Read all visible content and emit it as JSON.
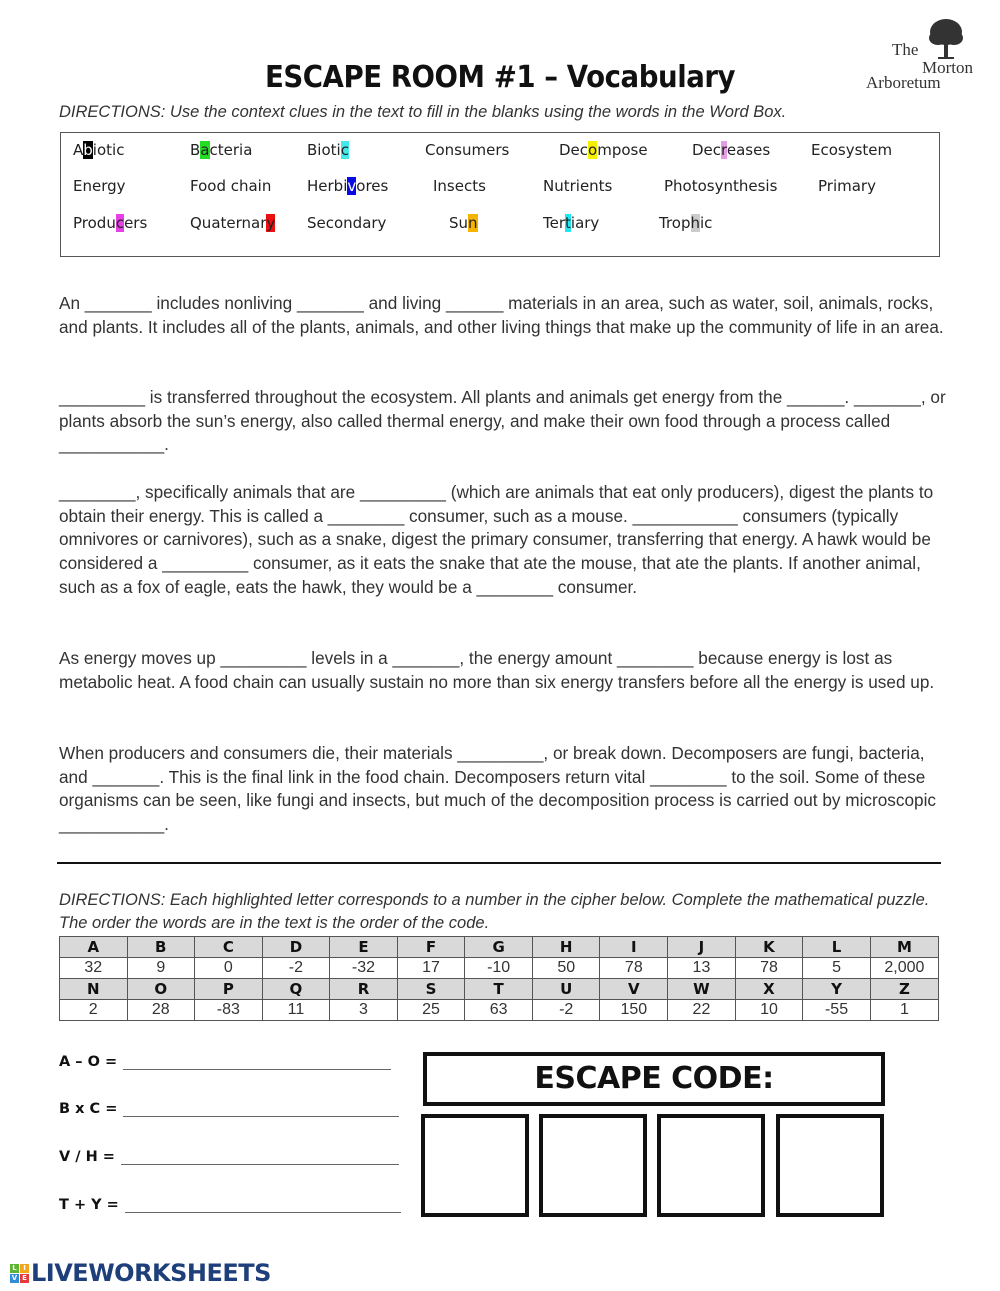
{
  "header": {
    "title": "ESCAPE ROOM #1 – Vocabulary",
    "logo": {
      "line1": "The",
      "line2": "Morton",
      "line3": "Arboretum",
      "icon": "tree-icon"
    }
  },
  "directions1": "DIRECTIONS: Use the context clues in the text to fill in the blanks using the words in the Word Box.",
  "word_box": {
    "rows": [
      [
        {
          "pre": "A",
          "hl": "b",
          "post": "iotic",
          "color": "#000000",
          "hl_text_color": "#ffffff"
        },
        {
          "pre": "B",
          "hl": "a",
          "post": "cteria",
          "color": "#22dd22"
        },
        {
          "pre": "Bioti",
          "hl": "c",
          "post": "",
          "color": "#44e8e8"
        },
        {
          "pre": "Consumers",
          "hl": "",
          "post": ""
        },
        {
          "pre": "Dec",
          "hl": "o",
          "post": "mpose",
          "color": "#f5f000"
        },
        {
          "pre": "Dec",
          "hl": "r",
          "post": "eases",
          "color": "#e79be5"
        },
        {
          "pre": "Ecosystem",
          "hl": "",
          "post": ""
        }
      ],
      [
        {
          "pre": "Energy",
          "hl": "",
          "post": ""
        },
        {
          "pre": "Food chain",
          "hl": "",
          "post": ""
        },
        {
          "pre": "Herbi",
          "hl": "v",
          "post": "ores",
          "color": "#0a0ae6",
          "hl_text_color": "#ffffff"
        },
        {
          "pre": "Insects",
          "hl": "",
          "post": ""
        },
        {
          "pre": "Nutrients",
          "hl": "",
          "post": ""
        },
        {
          "pre": "Photosynthesis",
          "hl": "",
          "post": ""
        },
        {
          "pre": "Primary",
          "hl": "",
          "post": ""
        }
      ],
      [
        {
          "pre": "Produ",
          "hl": "c",
          "post": "ers",
          "color": "#e640e6"
        },
        {
          "pre": "Quaternar",
          "hl": "y",
          "post": "",
          "color": "#e81010"
        },
        {
          "pre": "Secondary",
          "hl": "",
          "post": ""
        },
        {
          "pre": "Su",
          "hl": "n",
          "post": "",
          "color": "#f5b400"
        },
        {
          "pre": "Ter",
          "hl": "t",
          "post": "iary",
          "color": "#22e6f0"
        },
        {
          "pre": "Trop",
          "hl": "h",
          "post": "ic",
          "color": "#cccccc"
        }
      ]
    ]
  },
  "paragraphs": [
    "An _______ includes nonliving _______ and living ______ materials in an area, such as water, soil, animals, rocks, and plants. It includes all of the plants, animals, and other living things that make up the community of life in an area.",
    "_________ is transferred throughout the ecosystem. All plants and animals get energy from the ______. _______, or plants absorb the sun’s energy, also called thermal energy, and make their own food through a process called ___________.",
    "________, specifically animals that are _________ (which are animals that eat only producers), digest the plants to obtain their energy. This is called a ________ consumer, such as a mouse. ___________ consumers (typically omnivores or carnivores), such as a snake, digest the primary consumer, transferring that energy. A hawk would be considered a _________ consumer, as it eats the snake that ate the mouse, that ate the plants. If another animal, such as a fox of eagle, eats the hawk, they would be a ________ consumer.",
    "As energy moves up _________ levels in a _______, the energy amount ________ because energy is lost as metabolic heat. A food chain can usually sustain no more than six energy transfers before all the energy is used up.",
    "When producers and consumers die, their materials _________, or break down. Decomposers are fungi, bacteria, and _______. This is the final link in the food chain. Decomposers return vital ________ to the soil. Some of these organisms can be seen, like fungi and insects, but much of the decomposition process is carried out by microscopic ___________."
  ],
  "directions2": "DIRECTIONS: Each highlighted letter corresponds to a number in the cipher below. Complete the mathematical puzzle. The order the words are in the text is the order of the code.",
  "cipher": {
    "row1_letters": [
      "A",
      "B",
      "C",
      "D",
      "E",
      "F",
      "G",
      "H",
      "I",
      "J",
      "K",
      "L",
      "M"
    ],
    "row1_values": [
      "32",
      "9",
      "0",
      "-2",
      "-32",
      "17",
      "-10",
      "50",
      "78",
      "13",
      "78",
      "5",
      "2,000"
    ],
    "row2_letters": [
      "N",
      "O",
      "P",
      "Q",
      "R",
      "S",
      "T",
      "U",
      "V",
      "W",
      "X",
      "Y",
      "Z"
    ],
    "row2_values": [
      "2",
      "28",
      "-83",
      "11",
      "3",
      "25",
      "63",
      "-2",
      "150",
      "22",
      "10",
      "-55",
      "1"
    ]
  },
  "equations": [
    {
      "label": "A – O =",
      "value": ""
    },
    {
      "label": "B x C =",
      "value": ""
    },
    {
      "label": "V / H =",
      "value": ""
    },
    {
      "label": "T + Y =",
      "value": ""
    }
  ],
  "escape_code": {
    "title": "ESCAPE CODE:",
    "digits": [
      "",
      "",
      "",
      ""
    ]
  },
  "footer": {
    "brand": "LIVEWORKSHEETS",
    "badge_letters": [
      {
        "ch": "L",
        "color": "#5cb531"
      },
      {
        "ch": "I",
        "color": "#f2a81d"
      },
      {
        "ch": "V",
        "color": "#2f8ed8"
      },
      {
        "ch": "E",
        "color": "#e5393a"
      }
    ]
  }
}
